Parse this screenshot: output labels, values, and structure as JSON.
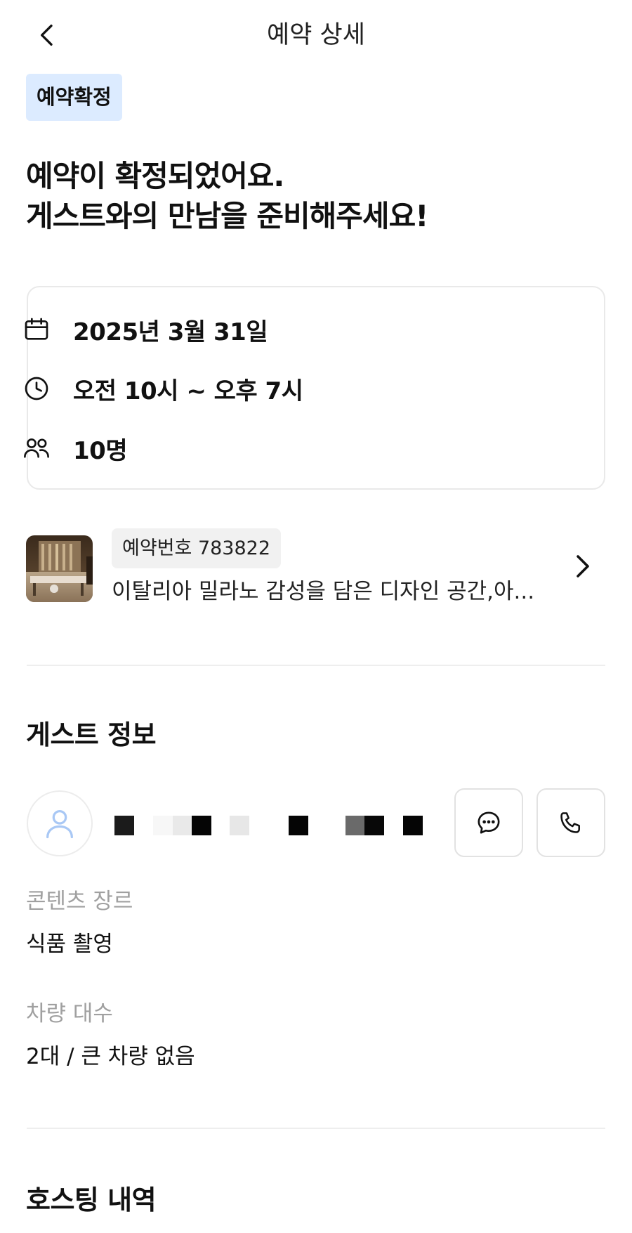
{
  "header": {
    "title": "예약 상세"
  },
  "status": {
    "label": "예약확정",
    "color": "#dcebff"
  },
  "headline": {
    "line1": "예약이 확정되었어요.",
    "line2": "게스트와의 만남을 준비해주세요!"
  },
  "booking": {
    "date": "2025년 3월 31일",
    "time": "오전 10시 ~ 오후 7시",
    "people": "10명"
  },
  "space": {
    "reservation_number": "예약번호 783822",
    "name": "이탈리아 밀라노 감성을 담은 디자인 공간,아..."
  },
  "guest_section": {
    "title": "게스트 정보",
    "fields": [
      {
        "label": "콘텐츠 장르",
        "value": "식품 촬영"
      },
      {
        "label": "차량 대수",
        "value": "2대 / 큰 차량 없음"
      }
    ]
  },
  "hosting_section": {
    "title": "호스팅 내역"
  },
  "icons": {
    "back": "chevron-left-icon",
    "date": "calendar-icon",
    "time": "clock-icon",
    "people": "users-icon",
    "chat": "chat-bubble-icon",
    "call": "phone-icon",
    "more": "chevron-right-icon"
  }
}
